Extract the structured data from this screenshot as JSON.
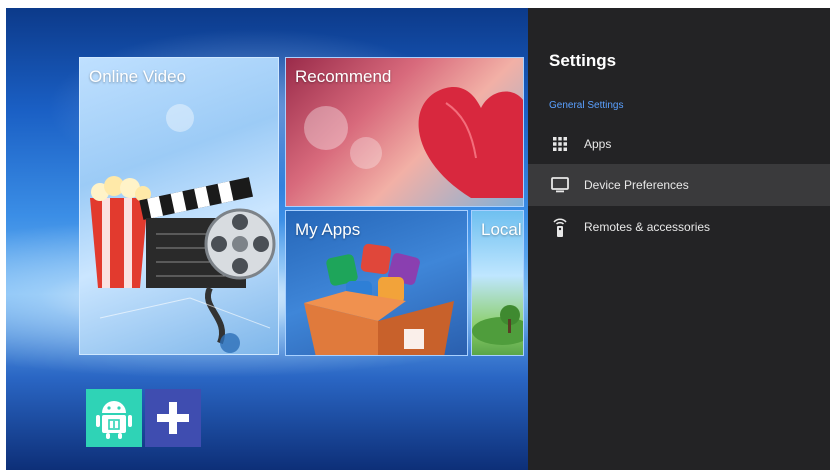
{
  "tiles": {
    "online_video": "Online Video",
    "recommend": "Recommend",
    "my_apps": "My Apps",
    "local": "Local"
  },
  "settings": {
    "title": "Settings",
    "section": "General Settings",
    "items": [
      {
        "label": "Apps",
        "icon": "grid-icon"
      },
      {
        "label": "Device Preferences",
        "icon": "tv-icon",
        "selected": true
      },
      {
        "label": "Remotes & accessories",
        "icon": "remote-icon"
      }
    ]
  },
  "colors": {
    "panel_bg": "#232325",
    "section_accent": "#5aa0ff",
    "selected_bg": "#3a3a3c",
    "android_button": "#2fd3b6",
    "add_button": "#3f4db0"
  }
}
